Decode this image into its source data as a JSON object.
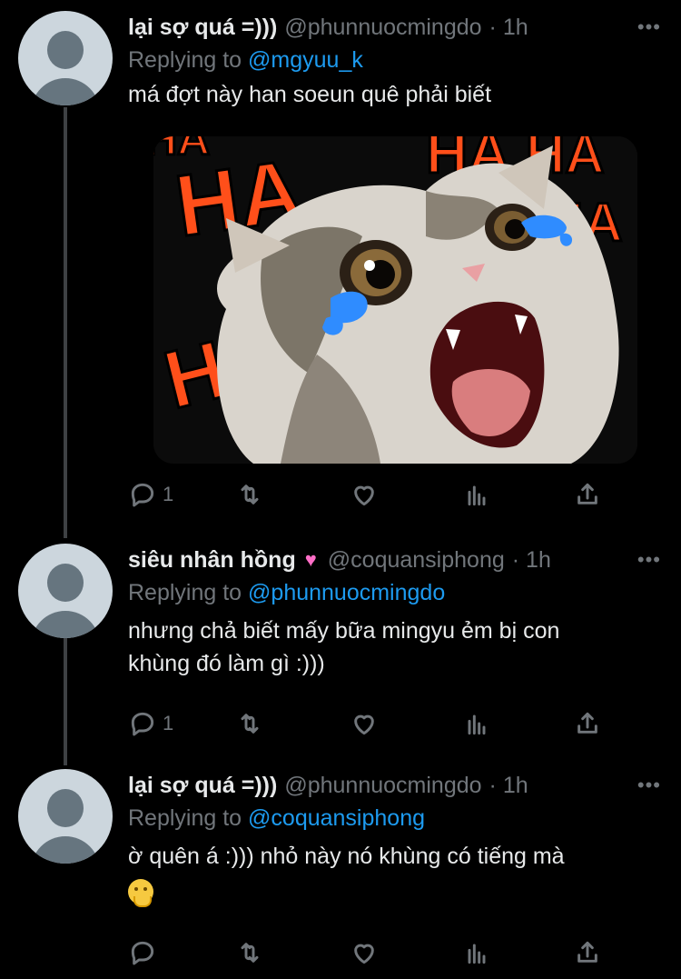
{
  "tweets": [
    {
      "display_name": "lại sợ quá =)))",
      "handle": "@phunnuocmingdo",
      "time": "· 1h",
      "replying_prefix": "Replying to",
      "replying_to": "@mgyuu_k",
      "text_lines": [
        "má đợt này han soeun quê phải biết"
      ],
      "media_text": [
        "HA",
        "HA",
        "HA",
        "HA",
        "HA",
        "HA"
      ],
      "reply_count": "1"
    },
    {
      "display_name": "siêu nhân hồng",
      "name_emoji": "♥",
      "handle": "@coquansiphong",
      "time": "· 1h",
      "replying_prefix": "Replying to",
      "replying_to": "@phunnuocmingdo",
      "text_lines": [
        "nhưng chả biết mấy bữa mingyu ẻm bị con",
        "khùng đó làm gì :)))"
      ],
      "reply_count": "1"
    },
    {
      "display_name": "lại sợ quá =)))",
      "handle": "@phunnuocmingdo",
      "time": "· 1h",
      "replying_prefix": "Replying to",
      "replying_to": "@coquansiphong",
      "text_lines": [
        "ờ quên á :))) nhỏ này nó khùng có tiếng mà"
      ],
      "reply_count": ""
    }
  ],
  "more_label": "•••",
  "icons": [
    "reply-icon",
    "retweet-icon",
    "like-icon",
    "analytics-icon",
    "share-icon"
  ],
  "colors": {
    "background": "#000000",
    "text": "#e7e9ea",
    "secondary": "#71767b",
    "mention": "#1d9bf0"
  }
}
